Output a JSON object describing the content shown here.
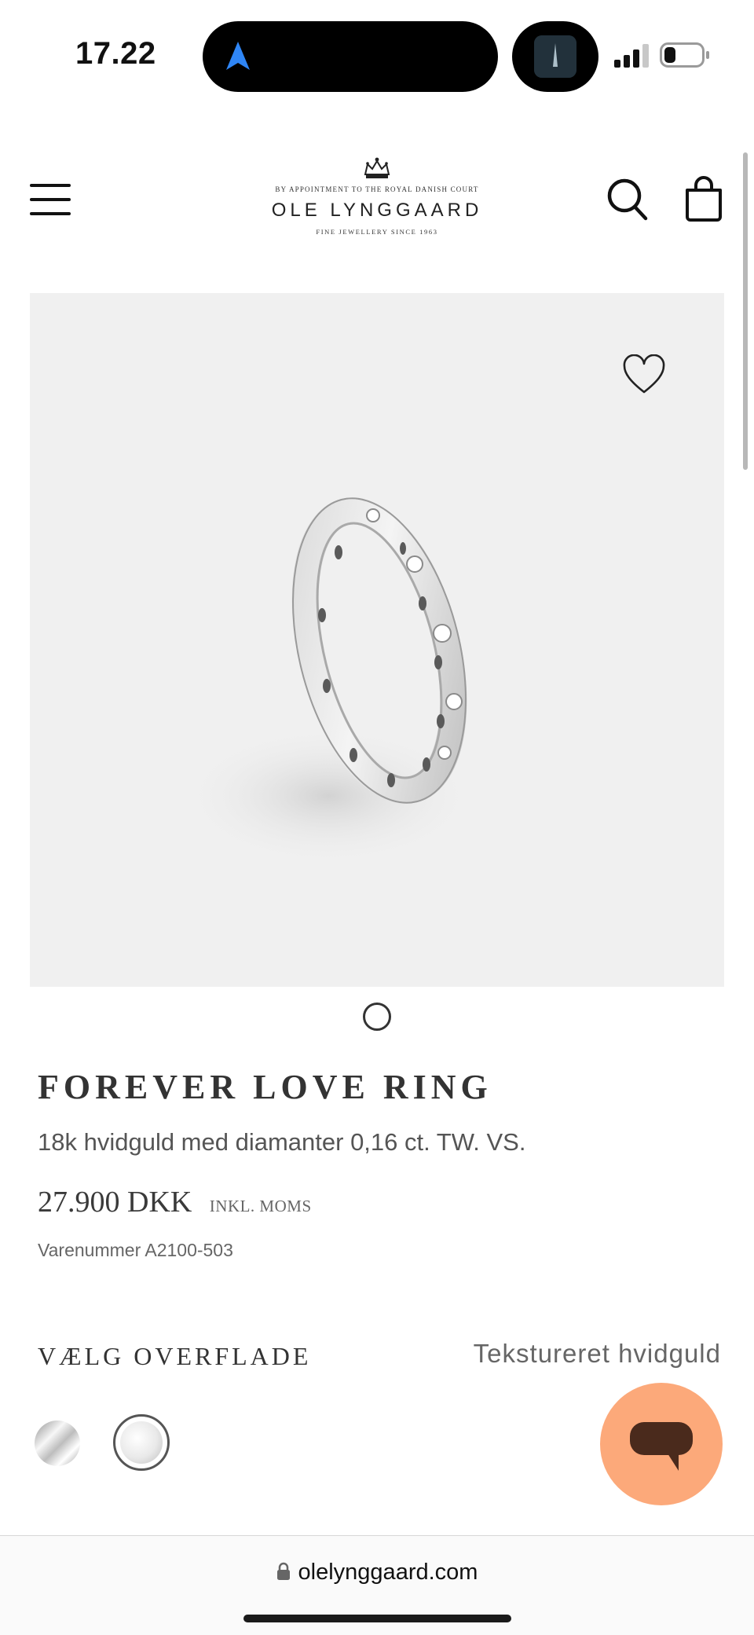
{
  "status_bar": {
    "time": "17.22"
  },
  "header": {
    "logo": {
      "appointment": "BY APPOINTMENT TO THE ROYAL DANISH COURT",
      "name": "OLE LYNGGAARD",
      "tagline": "FINE JEWELLERY SINCE 1963"
    },
    "icons": {
      "menu": "hamburger-menu-icon",
      "search": "search-icon",
      "bag": "shopping-bag-icon"
    }
  },
  "product": {
    "title": "FOREVER LOVE RING",
    "description": "18k hvidguld med diamanter 0,16 ct. TW. VS.",
    "price": "27.900 DKK",
    "vat_note": "INKL. MOMS",
    "sku": "Varenummer A2100-503",
    "image_count": 1,
    "active_image": 1
  },
  "finish": {
    "label": "VÆLG OVERFLADE",
    "selected": "Tekstureret hvidguld",
    "options": [
      "polished",
      "textured"
    ]
  },
  "browser": {
    "url": "olelynggaard.com"
  },
  "colors": {
    "chat_button": "#fca97a",
    "image_background": "#f0f0f0",
    "text_dark": "#333333"
  }
}
